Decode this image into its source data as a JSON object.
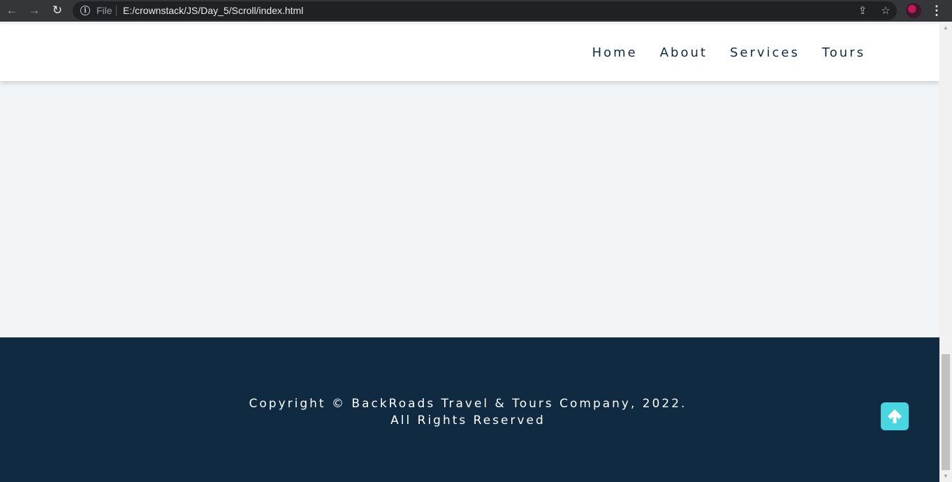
{
  "browser": {
    "back_glyph": "←",
    "forward_glyph": "→",
    "reload_glyph": "↻",
    "info_glyph": "i",
    "scheme_label": "File",
    "url": "E:/crownstack/JS/Day_5/Scroll/index.html",
    "menu_glyph": "⋮",
    "share_glyph": "⇪",
    "star_glyph": "☆"
  },
  "nav": {
    "links": [
      "Home",
      "About",
      "Services",
      "Tours"
    ]
  },
  "footer": {
    "line1": "Copyright © BackRoads Travel & Tours Company, 2022.",
    "line2": "All Rights Reserved"
  },
  "colors": {
    "accent": "#49d6e1",
    "dark": "#102a42",
    "background": "#f1f5f8"
  },
  "icons": {
    "scroll_top": "arrow-up-icon"
  }
}
